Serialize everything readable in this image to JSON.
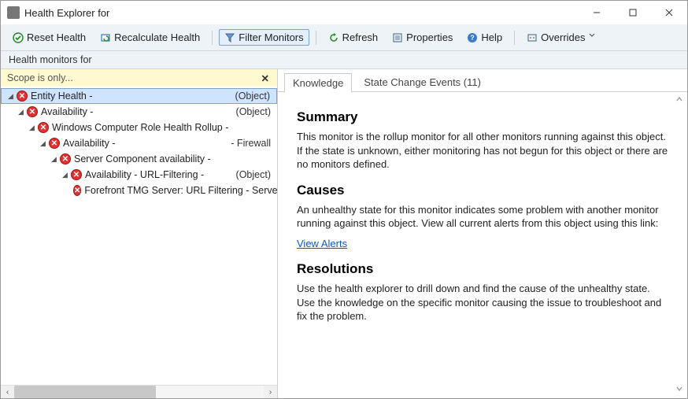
{
  "window": {
    "title": "Health Explorer for"
  },
  "toolbar": {
    "reset": "Reset Health",
    "recalc": "Recalculate Health",
    "filter": "Filter Monitors",
    "refresh": "Refresh",
    "properties": "Properties",
    "help": "Help",
    "overrides": "Overrides"
  },
  "subbar_text": "Health monitors for",
  "scope": {
    "text": "Scope is only..."
  },
  "tree": {
    "nodes": [
      {
        "depth": 0,
        "expanded": true,
        "state": "critical",
        "label": "Entity Health -",
        "class": "(Object)",
        "selected": true
      },
      {
        "depth": 1,
        "expanded": true,
        "state": "critical",
        "label": "Availability -",
        "class": "(Object)"
      },
      {
        "depth": 2,
        "expanded": true,
        "state": "critical",
        "label": "Windows Computer Role Health Rollup -",
        "class": ""
      },
      {
        "depth": 3,
        "expanded": true,
        "state": "critical",
        "label": "Availability -",
        "class": "- Firewall"
      },
      {
        "depth": 4,
        "expanded": true,
        "state": "critical",
        "label": "Server Component availability -",
        "class": ""
      },
      {
        "depth": 5,
        "expanded": true,
        "state": "critical",
        "label": "Availability - URL-Filtering -",
        "class": "(Object)"
      },
      {
        "depth": 6,
        "expanded": false,
        "leaf": true,
        "state": "critical",
        "label": "Forefront TMG Server: URL Filtering - Server",
        "class": ""
      }
    ]
  },
  "tabs": {
    "knowledge": "Knowledge",
    "state_change": "State Change Events (11)"
  },
  "knowledge": {
    "summary_h": "Summary",
    "summary_p": "This monitor is the rollup monitor for all other monitors running against this object. If the state is unknown, either monitoring has not begun for this object or there are no monitors defined.",
    "causes_h": "Causes",
    "causes_p": "An unhealthy state for this monitor indicates some problem with another monitor running against this object. View all current alerts from this object using this link:",
    "view_alerts": "View Alerts",
    "resolutions_h": "Resolutions",
    "resolutions_p": "Use the health explorer to drill down and find the cause of the unhealthy state. Use the knowledge on the specific monitor causing the issue to troubleshoot and fix the problem."
  }
}
